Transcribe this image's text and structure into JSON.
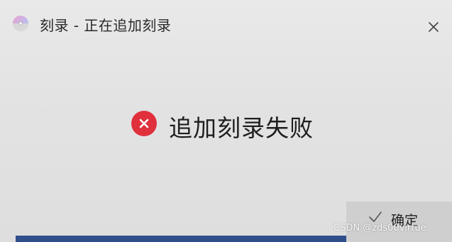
{
  "window": {
    "title": "刻录 - 正在追加刻录"
  },
  "message": {
    "text": "追加刻录失败"
  },
  "footer": {
    "ok_label": "确定"
  },
  "watermark": "CSDN @zds00virtue",
  "icons": {
    "app": "disc-burn-icon",
    "close": "close-icon",
    "error": "error-icon",
    "ok": "check-icon"
  },
  "colors": {
    "error_red": "#e0303c",
    "ok_button_bg": "#cfcfcf",
    "background": "#e4e4e4"
  }
}
